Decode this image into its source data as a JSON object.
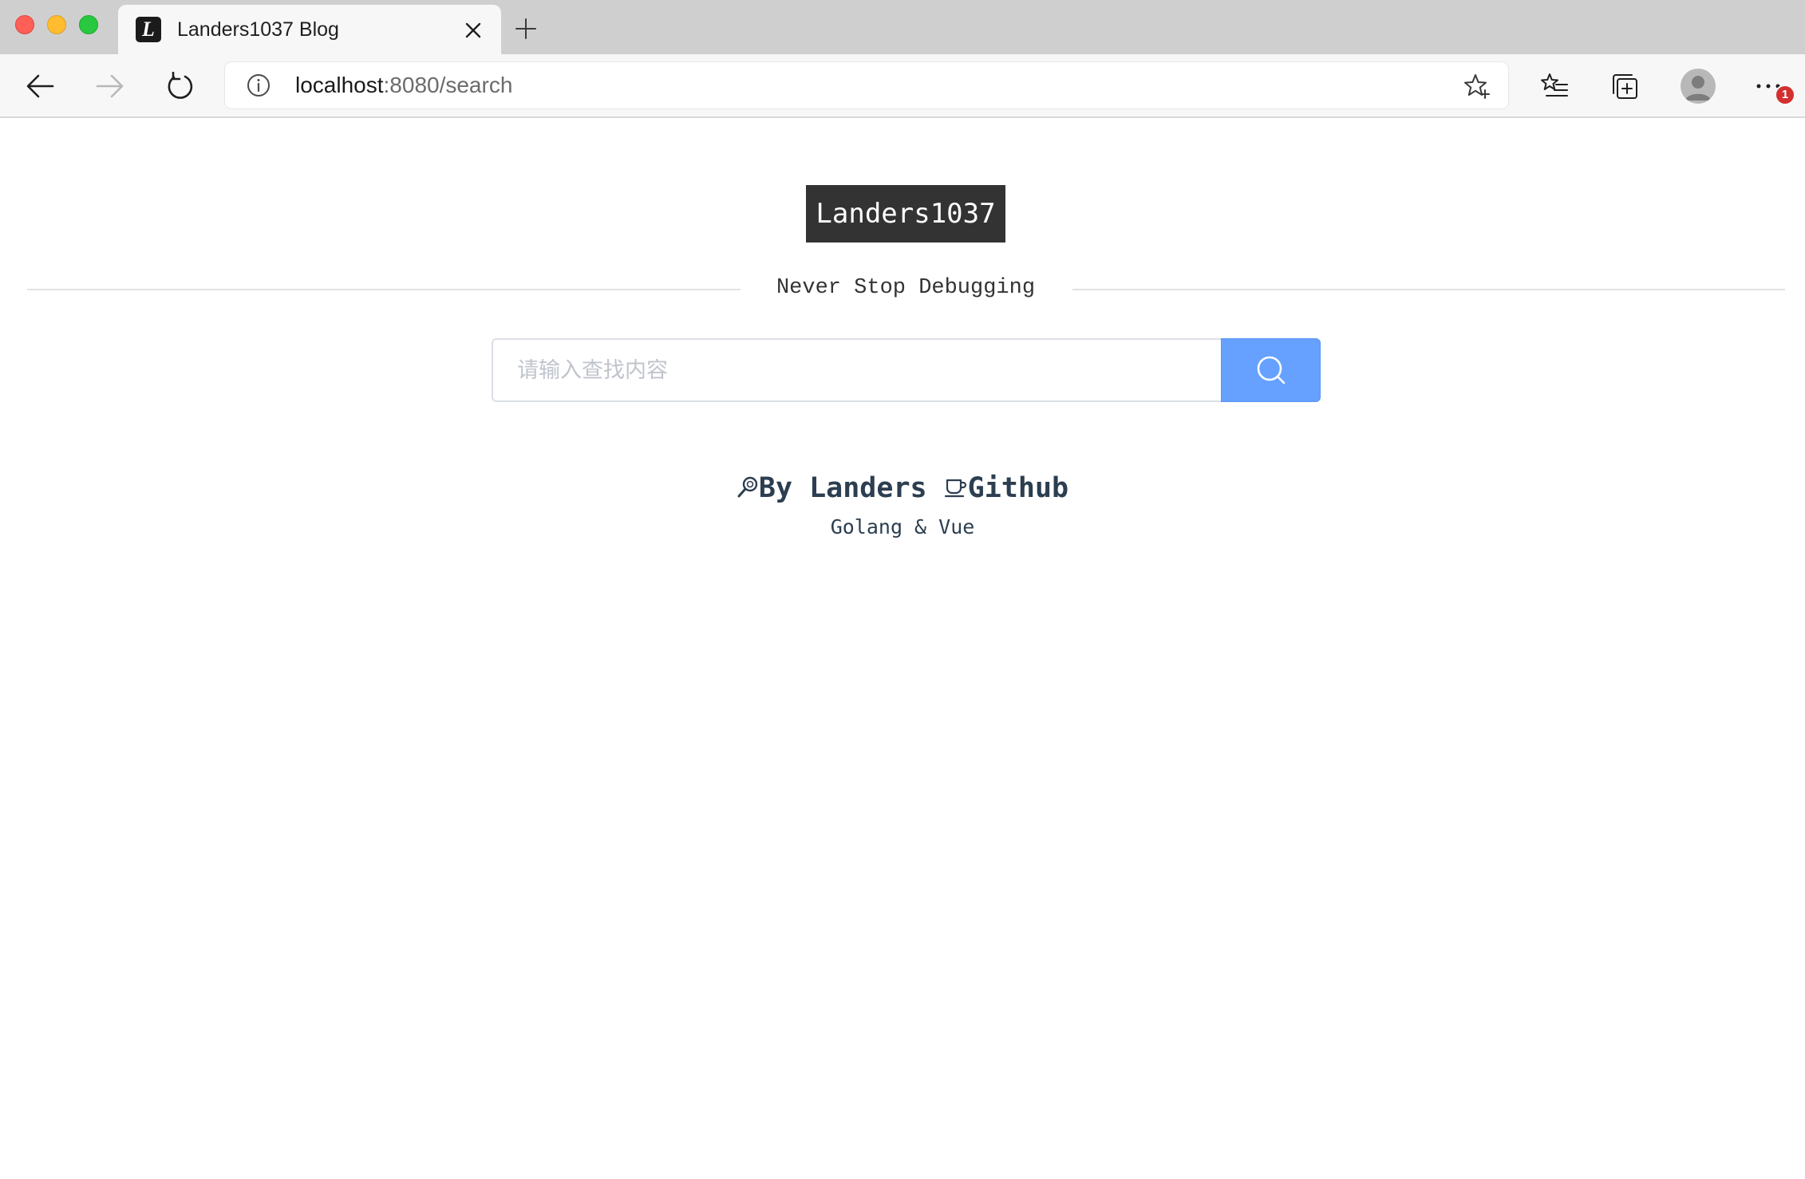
{
  "browser": {
    "tab": {
      "title": "Landers1037 Blog",
      "favicon_letter": "L"
    },
    "address_bar": {
      "host": "localhost",
      "rest": ":8080/search"
    },
    "notification_badge": "1"
  },
  "page": {
    "logo": "Landers1037",
    "slogan": "Never Stop Debugging",
    "search": {
      "placeholder": "请输入查找内容",
      "value": ""
    },
    "footer": {
      "author_link": "By Landers",
      "github_link": "Github",
      "tech_stack": "Golang & Vue"
    }
  },
  "colors": {
    "logo_bg": "#333333",
    "search_button": "#66a1ff",
    "text": "#2c3e50"
  }
}
